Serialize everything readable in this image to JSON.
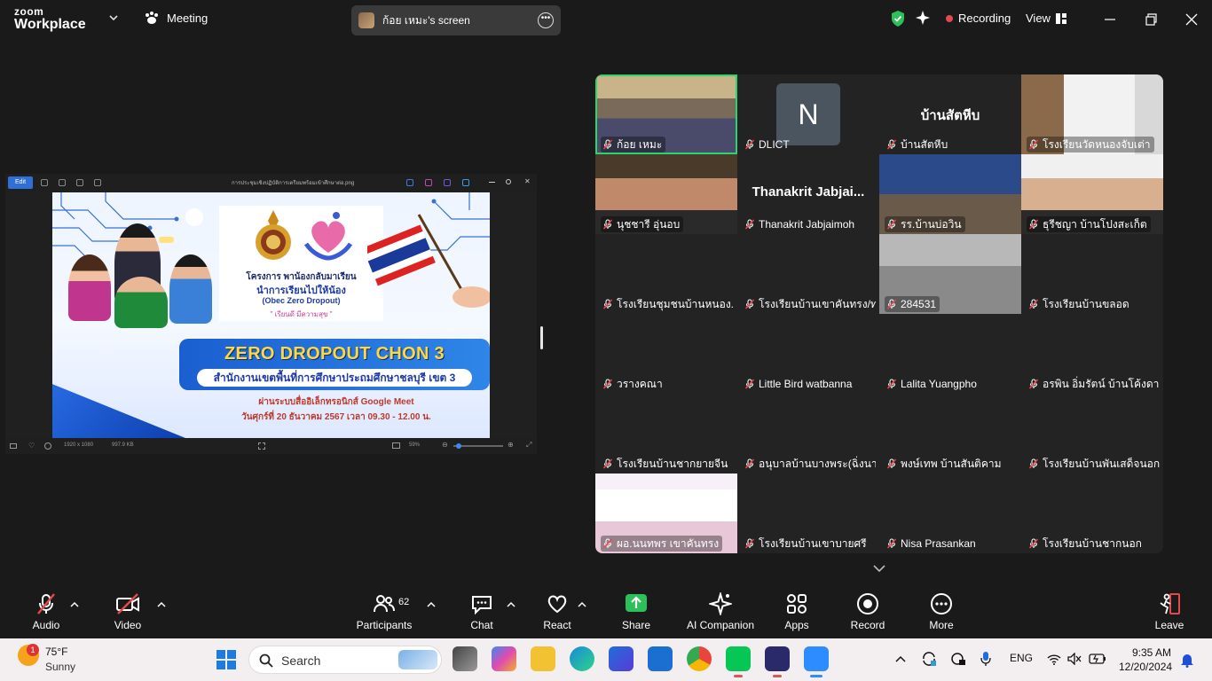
{
  "app": {
    "logo_top": "zoom",
    "logo_bottom": "Workplace",
    "meeting_label": "Meeting",
    "share_label": "ก้อย เหมะ's screen",
    "recording_label": "Recording",
    "view_label": "View"
  },
  "share": {
    "window_title": "การประชุมเชิงปฏิบัติการเตรียมพร้อมเข้าศึกษาต่อ.png",
    "edit_label": "Edit",
    "status_dims": "1920 x 1080",
    "status_size": "997.9 KB",
    "zoom_level": "59%",
    "banner": {
      "line1": "โครงการ พาน้องกลับมาเรียน",
      "line2": "นำการเรียนไปให้น้อง",
      "line3": "(Obec Zero Dropout)",
      "line4": "\" เรียนดี มีความสุข \"",
      "headline": "ZERO DROPOUT CHON 3",
      "office": "สำนักงานเขตพื้นที่การศึกษาประถมศึกษาชลบุรี เขต 3",
      "via": "ผ่านระบบสื่ออิเล็กทรอนิกส์ Google Meet",
      "date": "วันศุกร์ที่ 20 ธันวาคม 2567 เวลา 09.30 - 12.00 น."
    }
  },
  "gallery": {
    "tiles": [
      {
        "name": "ก้อย เหมะ",
        "kind": "video",
        "active": true
      },
      {
        "name": "DLICT",
        "kind": "avatar",
        "initial": "N"
      },
      {
        "name": "บ้านสัตหีบ",
        "kind": "text",
        "big": "บ้านสัตหีบ"
      },
      {
        "name": "โรงเรียนวัดหนองจับเต่า",
        "kind": "video"
      },
      {
        "name": "นุชชารี  อุ่นอบ",
        "kind": "video"
      },
      {
        "name": "Thanakrit Jabjaimoh",
        "kind": "text",
        "big": "Thanakrit  Jabjai..."
      },
      {
        "name": "รร.บ้านบ่อวิน",
        "kind": "video"
      },
      {
        "name": "ธุรีชญา บ้านโปงสะเก็ต",
        "kind": "video"
      },
      {
        "name": "โรงเรียนชุมชนบ้านหนอง...",
        "kind": "empty"
      },
      {
        "name": "โรงเรียนบ้านเขาคันทรง/ท...",
        "kind": "empty"
      },
      {
        "name": "284531",
        "kind": "video"
      },
      {
        "name": "โรงเรียนบ้านขลอด",
        "kind": "empty"
      },
      {
        "name": "วรางคณา",
        "kind": "empty"
      },
      {
        "name": "Little Bird watbanna",
        "kind": "empty"
      },
      {
        "name": "Lalita Yuangpho",
        "kind": "empty"
      },
      {
        "name": "อรพิน อิ่มรัตน์ บ้านโค้งดารา",
        "kind": "empty"
      },
      {
        "name": "โรงเรียนบ้านชากยายจีน",
        "kind": "empty"
      },
      {
        "name": "อนุบาลบ้านบางพระ(ฉิ่งนา...",
        "kind": "empty"
      },
      {
        "name": "พงษ์เทพ บ้านสันติคาม",
        "kind": "empty"
      },
      {
        "name": "โรงเรียนบ้านพันเสด็จนอก",
        "kind": "empty"
      },
      {
        "name": "ผอ.นนทพร เขาคันทรง",
        "kind": "video"
      },
      {
        "name": "โรงเรียนบ้านเขาบายศรี",
        "kind": "empty"
      },
      {
        "name": "Nisa  Prasankan",
        "kind": "empty"
      },
      {
        "name": "โรงเรียนบ้านชากนอก",
        "kind": "empty"
      }
    ]
  },
  "toolbar": {
    "audio": "Audio",
    "video": "Video",
    "participants": "Participants",
    "participants_count": "62",
    "chat": "Chat",
    "react": "React",
    "share": "Share",
    "ai": "AI Companion",
    "apps": "Apps",
    "record": "Record",
    "more": "More",
    "leave": "Leave"
  },
  "taskbar": {
    "temp": "75°F",
    "condition": "Sunny",
    "weather_badge": "1",
    "search_placeholder": "Search",
    "lang": "ENG",
    "time": "9:35 AM",
    "date": "12/20/2024"
  }
}
